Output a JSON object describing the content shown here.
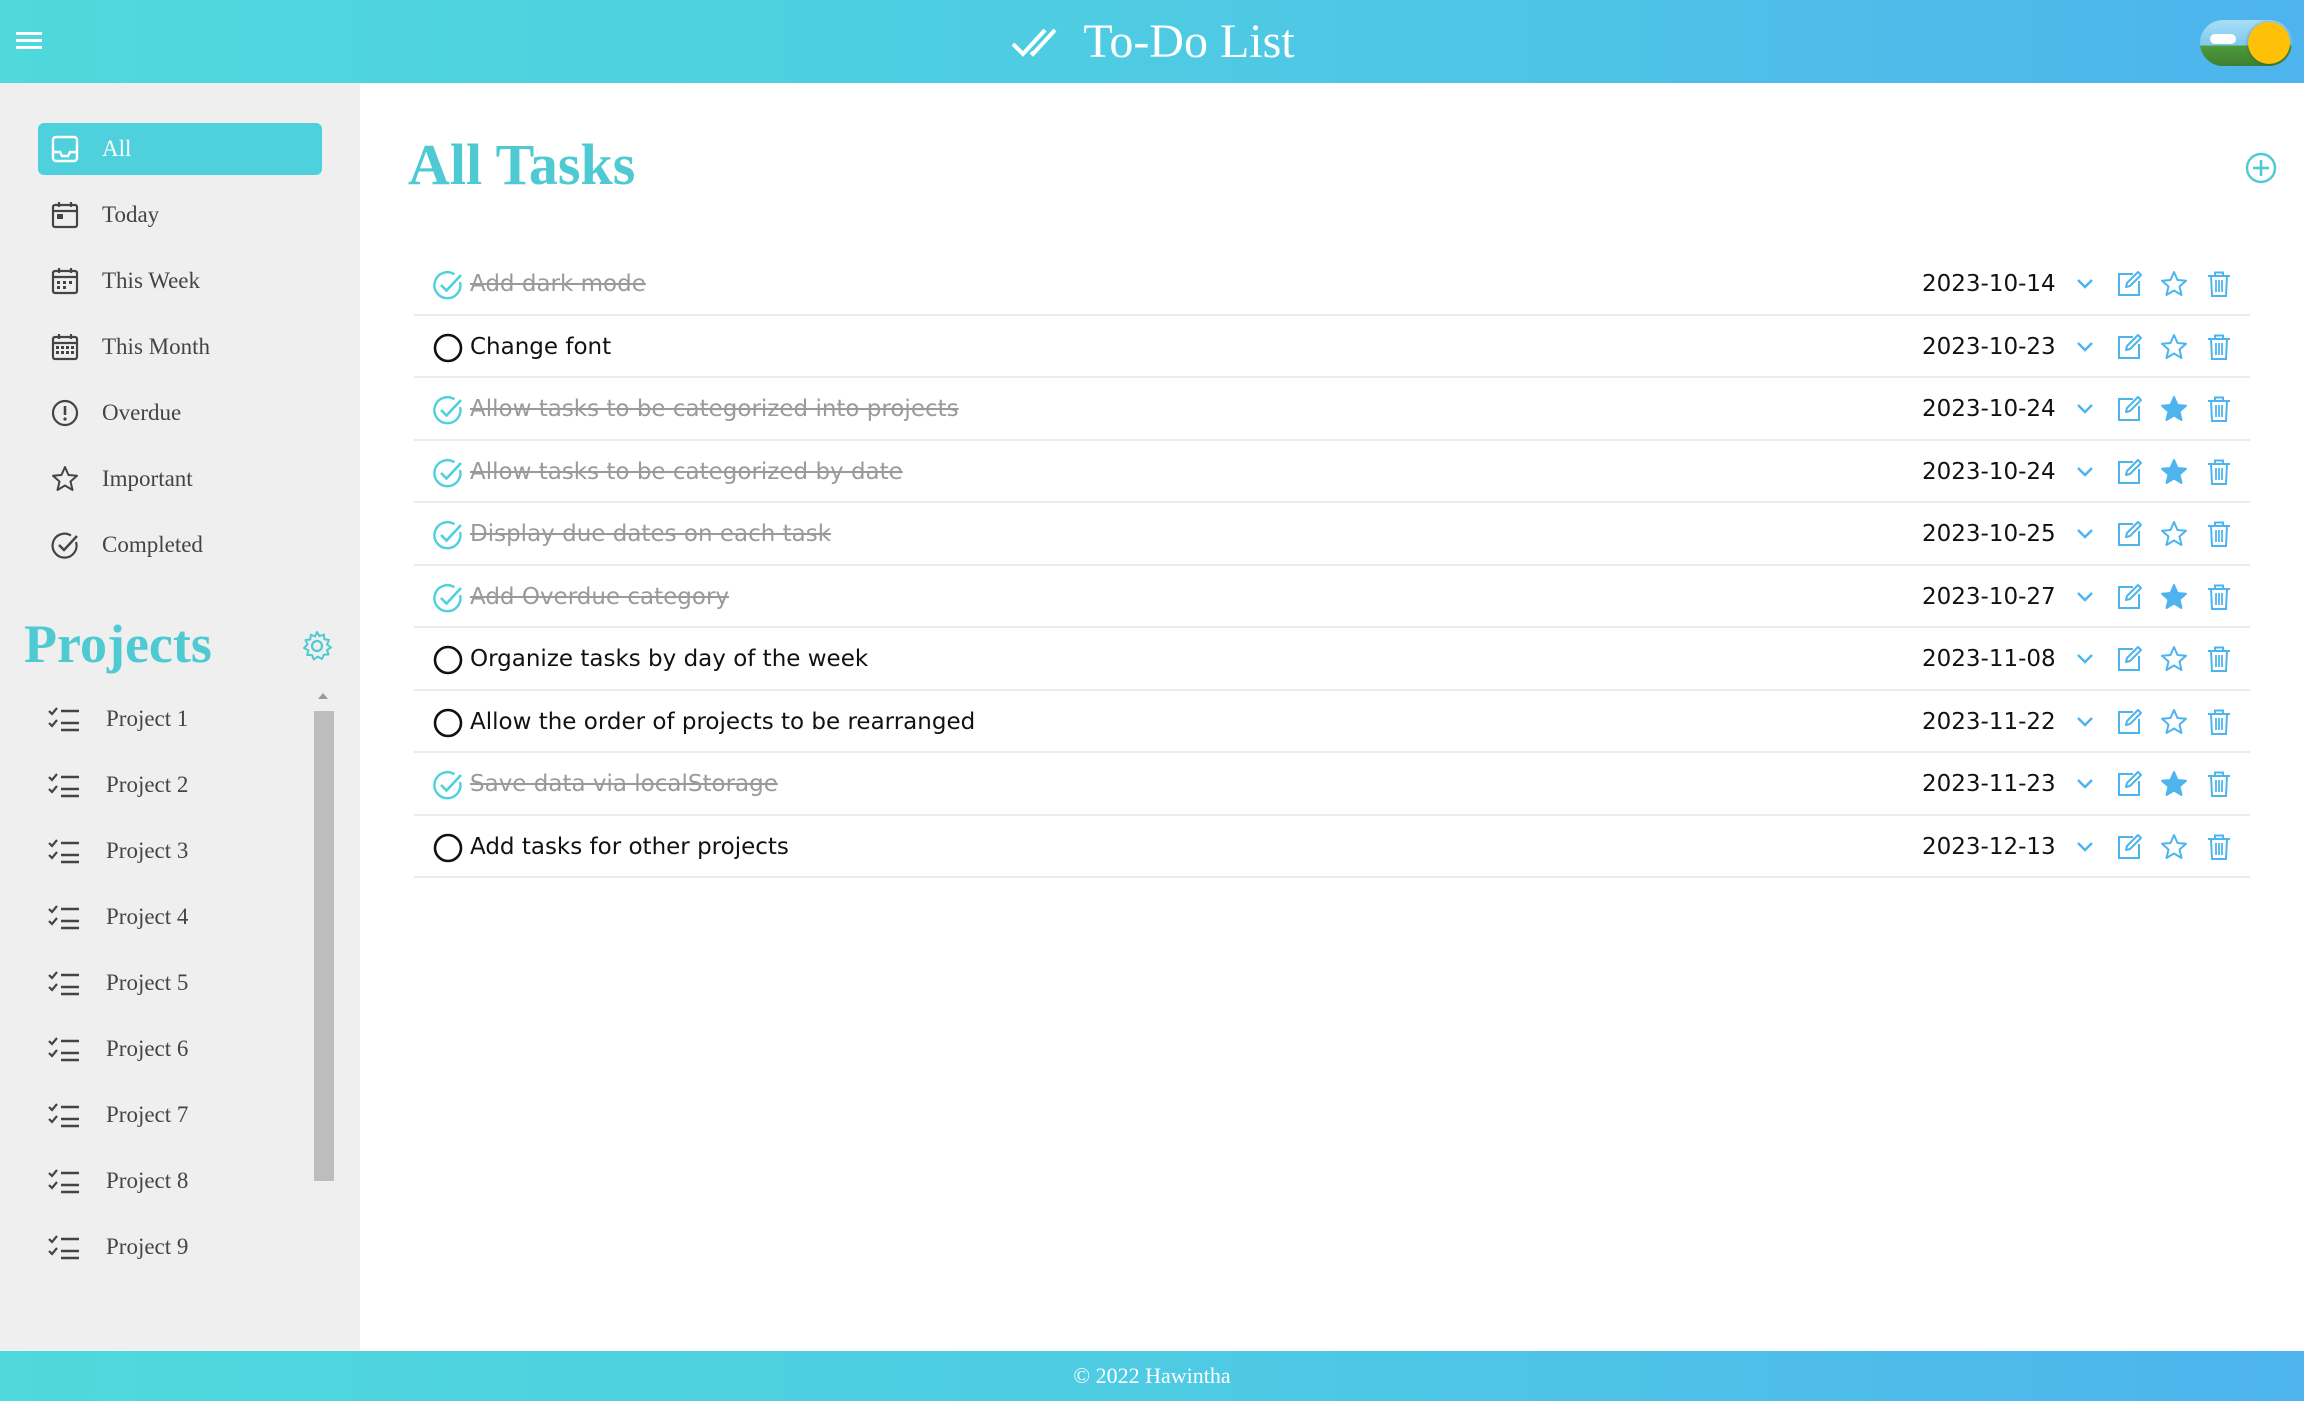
{
  "header": {
    "title": "To-Do List",
    "brand_icon": "double-check-icon",
    "menu_icon": "hamburger-menu-icon",
    "theme_toggle": "light"
  },
  "nav": {
    "items": [
      {
        "label": "All",
        "icon": "inbox-icon",
        "active": true
      },
      {
        "label": "Today",
        "icon": "calendar-day-icon",
        "active": false
      },
      {
        "label": "This Week",
        "icon": "calendar-week-icon",
        "active": false
      },
      {
        "label": "This Month",
        "icon": "calendar-month-icon",
        "active": false
      },
      {
        "label": "Overdue",
        "icon": "exclamation-circle-icon",
        "active": false
      },
      {
        "label": "Important",
        "icon": "star-icon",
        "active": false
      },
      {
        "label": "Completed",
        "icon": "check-circle-icon",
        "active": false
      }
    ]
  },
  "projects": {
    "title": "Projects",
    "settings_icon": "gear-icon",
    "items": [
      {
        "label": "Project 1"
      },
      {
        "label": "Project 2"
      },
      {
        "label": "Project 3"
      },
      {
        "label": "Project 4"
      },
      {
        "label": "Project 5"
      },
      {
        "label": "Project 6"
      },
      {
        "label": "Project 7"
      },
      {
        "label": "Project 8"
      },
      {
        "label": "Project 9"
      }
    ]
  },
  "main": {
    "title": "All Tasks",
    "add_icon": "plus-circle-icon",
    "tasks": [
      {
        "title": "Add dark mode",
        "date": "2023-10-14",
        "completed": true,
        "important": false
      },
      {
        "title": "Change font",
        "date": "2023-10-23",
        "completed": false,
        "important": false
      },
      {
        "title": "Allow tasks to be categorized into projects",
        "date": "2023-10-24",
        "completed": true,
        "important": true
      },
      {
        "title": "Allow tasks to be categorized by date",
        "date": "2023-10-24",
        "completed": true,
        "important": true
      },
      {
        "title": "Display due dates on each task",
        "date": "2023-10-25",
        "completed": true,
        "important": false
      },
      {
        "title": "Add Overdue category",
        "date": "2023-10-27",
        "completed": true,
        "important": true
      },
      {
        "title": "Organize tasks by day of the week",
        "date": "2023-11-08",
        "completed": false,
        "important": false
      },
      {
        "title": "Allow the order of projects to be rearranged",
        "date": "2023-11-22",
        "completed": false,
        "important": false
      },
      {
        "title": "Save data via localStorage",
        "date": "2023-11-23",
        "completed": true,
        "important": true
      },
      {
        "title": "Add tasks for other projects",
        "date": "2023-12-13",
        "completed": false,
        "important": false
      }
    ]
  },
  "footer": {
    "text": "© 2022 Hawintha"
  },
  "colors": {
    "accent": "#4fc9d2",
    "accent_blue": "#4db4ed",
    "sidebar_bg": "#efefef",
    "done_text": "#9a9a9a",
    "toggle_sun": "#ffc107"
  }
}
